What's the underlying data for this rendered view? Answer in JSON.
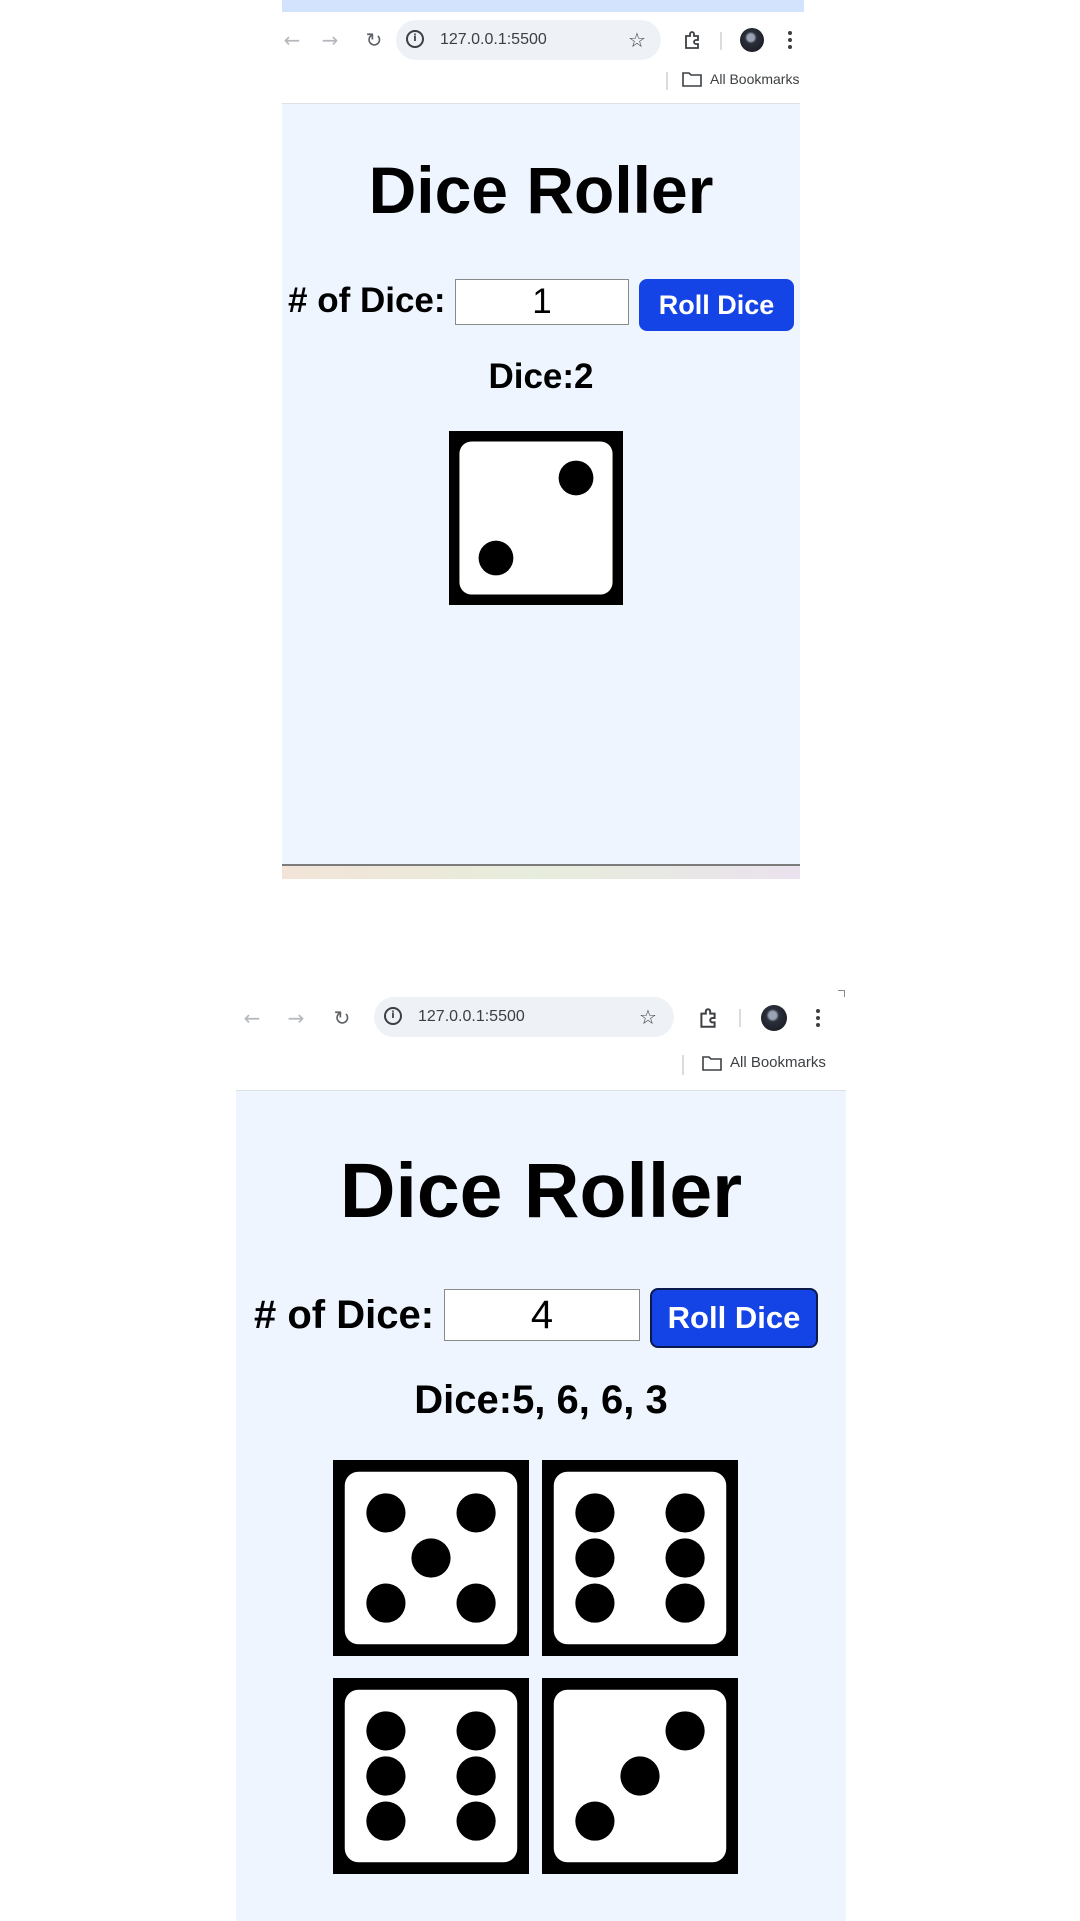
{
  "screens": [
    {
      "browser": {
        "url": "127.0.0.1:5500",
        "bookmarks_label": "All Bookmarks",
        "icons": [
          "back-arrow-icon",
          "forward-arrow-icon",
          "reload-icon",
          "info-icon",
          "star-icon",
          "extensions-icon",
          "profile-avatar",
          "more-menu-icon",
          "folder-icon"
        ]
      },
      "app": {
        "title": "Dice Roller",
        "dice_count_label": "# of Dice:",
        "dice_count_value": "1",
        "roll_button_label": "Roll Dice",
        "result_text": "Dice:2",
        "dice_values": [
          2
        ]
      }
    },
    {
      "browser": {
        "url": "127.0.0.1:5500",
        "bookmarks_label": "All Bookmarks",
        "icons": [
          "back-arrow-icon",
          "forward-arrow-icon",
          "reload-icon",
          "info-icon",
          "star-icon",
          "extensions-icon",
          "profile-avatar",
          "more-menu-icon",
          "folder-icon"
        ]
      },
      "app": {
        "title": "Dice Roller",
        "dice_count_label": "# of Dice:",
        "dice_count_value": "4",
        "roll_button_label": "Roll Dice",
        "result_text": "Dice:5, 6, 6, 3",
        "dice_values": [
          5,
          6,
          6,
          3
        ]
      }
    }
  ],
  "colors": {
    "page_background": "#eef5fe",
    "button_blue": "#1443e6",
    "die_face": "#000000",
    "die_pip_area": "#ffffff"
  }
}
